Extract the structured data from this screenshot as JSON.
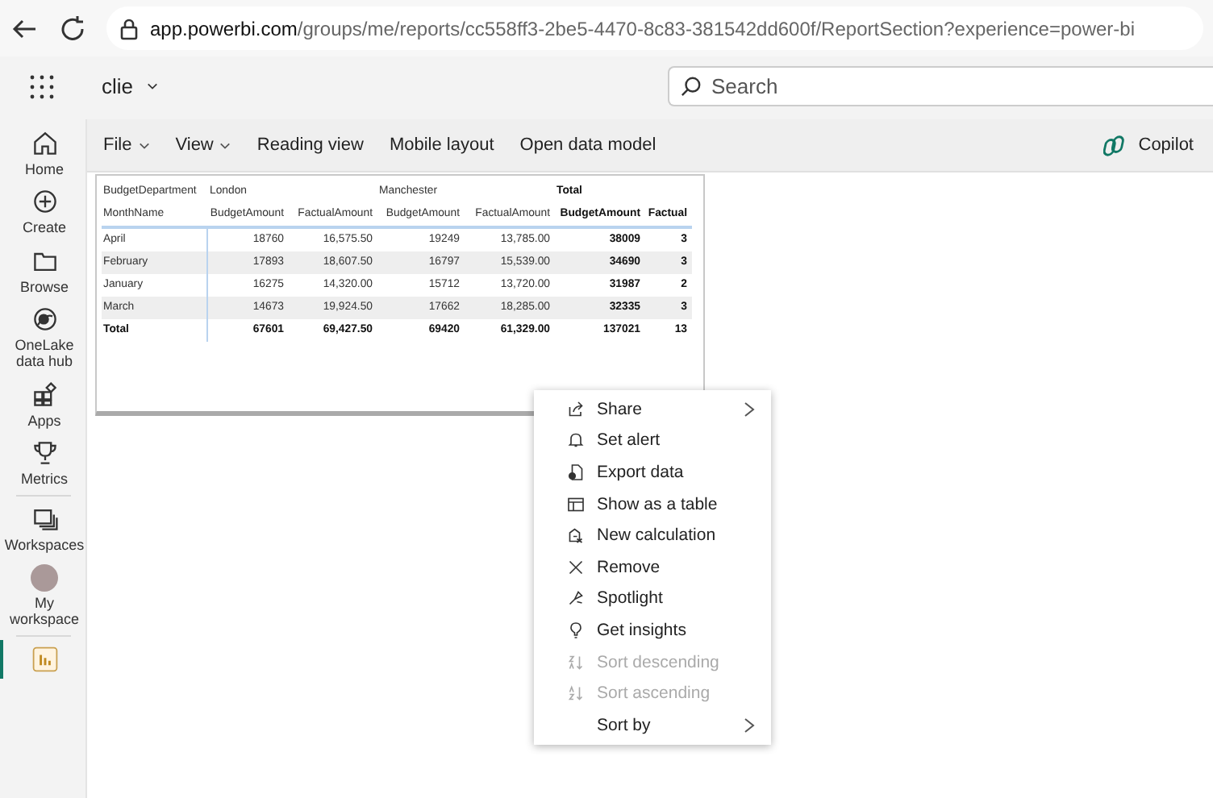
{
  "browser": {
    "url_host": "app.powerbi.com",
    "url_path": "/groups/me/reports/cc558ff3-2be5-4470-8c83-381542dd600f/ReportSection?experience=power-bi"
  },
  "app_bar": {
    "workspace": "clie",
    "search": {
      "placeholder": "Search"
    }
  },
  "rail": [
    {
      "label": "Home",
      "selected": false
    },
    {
      "label": "Create",
      "selected": false
    },
    {
      "label": "Browse",
      "selected": false
    },
    {
      "label": "OneLake data hub",
      "selected": false
    },
    {
      "label": "Apps",
      "selected": false
    },
    {
      "label": "Metrics",
      "selected": false
    },
    {
      "label": "Workspaces",
      "selected": false
    },
    {
      "label": "My workspace",
      "selected": false
    },
    {
      "selected": true
    }
  ],
  "ribbon": {
    "menus": [
      {
        "label": "File",
        "dropdown": true
      },
      {
        "label": "View",
        "dropdown": true
      },
      {
        "label": "Reading view",
        "dropdown": false
      },
      {
        "label": "Mobile layout",
        "dropdown": false
      },
      {
        "label": "Open data model",
        "dropdown": false
      }
    ],
    "copilot": "Copilot"
  },
  "matrix": {
    "column_header_title": "BudgetDepartment",
    "column_groups": [
      "London",
      "Manchester",
      "Total"
    ],
    "columns": [
      "MonthName",
      "BudgetAmount",
      "FactualAmount",
      "BudgetAmount",
      "FactualAmount",
      "BudgetAmount",
      "Factual"
    ],
    "rows": [
      {
        "cells": [
          "April",
          "18760",
          "16,575.50",
          "19249",
          "13,785.00",
          "38009",
          "3"
        ],
        "total": false
      },
      {
        "cells": [
          "February",
          "17893",
          "18,607.50",
          "16797",
          "15,539.00",
          "34690",
          "3"
        ],
        "total": false
      },
      {
        "cells": [
          "January",
          "16275",
          "14,320.00",
          "15712",
          "13,720.00",
          "31987",
          "2"
        ],
        "total": false
      },
      {
        "cells": [
          "March",
          "14673",
          "19,924.50",
          "17662",
          "18,285.00",
          "32335",
          "3"
        ],
        "total": false
      },
      {
        "cells": [
          "Total",
          "67601",
          "69,427.50",
          "69420",
          "61,329.00",
          "137021",
          "13"
        ],
        "total": true
      }
    ]
  },
  "context_menu": [
    {
      "label": "Share",
      "submenu": true,
      "disabled": false
    },
    {
      "label": "Set alert",
      "submenu": false,
      "disabled": false
    },
    {
      "label": "Export data",
      "submenu": false,
      "disabled": false
    },
    {
      "label": "Show as a table",
      "submenu": false,
      "disabled": false
    },
    {
      "label": "New calculation",
      "submenu": false,
      "disabled": false
    },
    {
      "label": "Remove",
      "submenu": false,
      "disabled": false
    },
    {
      "label": "Spotlight",
      "submenu": false,
      "disabled": false
    },
    {
      "label": "Get insights",
      "submenu": false,
      "disabled": false
    },
    {
      "label": "Sort descending",
      "submenu": false,
      "disabled": true
    },
    {
      "label": "Sort ascending",
      "submenu": false,
      "disabled": true
    },
    {
      "label": "Sort by",
      "submenu": true,
      "disabled": false
    }
  ]
}
